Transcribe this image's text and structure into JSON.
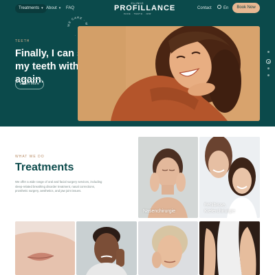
{
  "nav": {
    "treatments": "Treatments",
    "about": "About",
    "faq": "FAQ",
    "contact": "Contact",
    "language": "En",
    "book": "Book Now"
  },
  "logo": {
    "top": "CLINIC",
    "main": "PROFILLANCE",
    "sub": "FACE · TEETH · JAW"
  },
  "badge": {
    "text": "WE CARE · WE CARE · "
  },
  "hero": {
    "eyebrow": "TEETH",
    "title": "Finally, I can show my teeth with joy again.",
    "cta": "Learn More",
    "slides_total": 4,
    "active_slide": 2
  },
  "treatments": {
    "eyebrow": "WHAT WE DO",
    "title": "Treatments",
    "description": "We offer a wide range of oral and facial surgery services, including sleep-related breathing disorder treatment, nasal corrections, prosthetic surgery, aesthetics, and jaw joint issues.",
    "tiles": [
      {
        "label": "Nasenchirurgie"
      },
      {
        "label_line1": "Fehlbisse,",
        "label_line2": "Kieferchirurgie"
      }
    ]
  },
  "colors": {
    "hero_bg": "#0b4a4b",
    "accent": "#e7b892",
    "eyebrow": "#b78a63",
    "title": "#0b4a4b"
  }
}
